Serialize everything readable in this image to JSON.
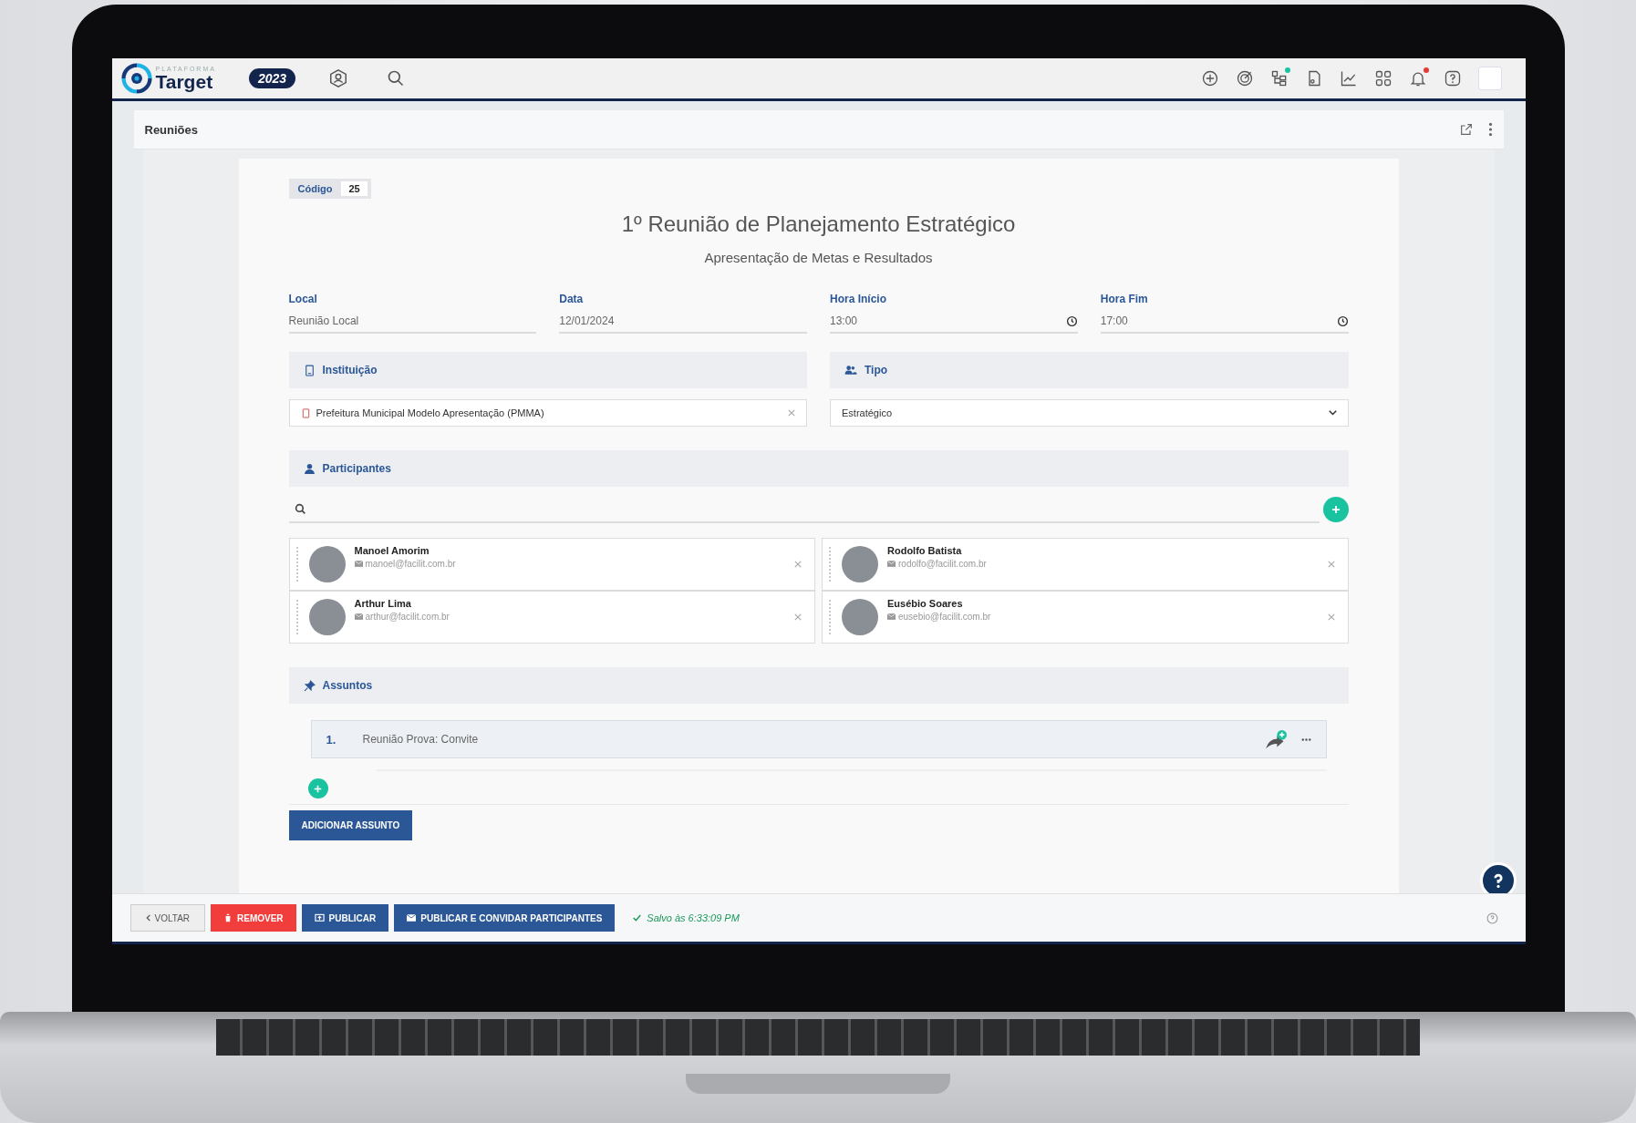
{
  "topbar": {
    "logo_small": "PLATAFORMA",
    "logo": "Target",
    "year": "2023",
    "icons": [
      {
        "kind": "plus"
      },
      {
        "kind": "target"
      },
      {
        "kind": "tree",
        "color": "#19c3a0"
      },
      {
        "kind": "doc"
      },
      {
        "kind": "chart"
      },
      {
        "kind": "grid"
      },
      {
        "kind": "bell",
        "color": "#e53935"
      },
      {
        "kind": "help"
      }
    ]
  },
  "panel": {
    "title": "Reuniões"
  },
  "code": {
    "label": "Código",
    "value": "25"
  },
  "title": "1º Reunião de Planejamento Estratégico",
  "subtitle": "Apresentação de Metas e Resultados",
  "fields": [
    {
      "label": "Local",
      "value": "Reunião Local",
      "kind": "text"
    },
    {
      "label": "Data",
      "value": "12/01/2024",
      "kind": "text"
    },
    {
      "label": "Hora Início",
      "value": "13:00",
      "kind": "time"
    },
    {
      "label": "Hora Fim",
      "value": "17:00",
      "kind": "time"
    }
  ],
  "institution": {
    "header": "Instituição",
    "value": "Prefeitura Municipal Modelo Apresentação (PMMA)"
  },
  "type": {
    "header": "Tipo",
    "value": "Estratégico"
  },
  "participants": {
    "header": "Participantes",
    "people": [
      {
        "name": "Manoel Amorim",
        "email": "manoel@facilit.com.br"
      },
      {
        "name": "Rodolfo Batista",
        "email": "rodolfo@facilit.com.br"
      },
      {
        "name": "Arthur Lima",
        "email": "arthur@facilit.com.br"
      },
      {
        "name": "Eusébio Soares",
        "email": "eusebio@facilit.com.br"
      }
    ]
  },
  "subjects": {
    "header": "Assuntos",
    "items": [
      {
        "number": "1.",
        "text": "Reunião Prova: Convite"
      }
    ],
    "add_button": "ADICIONAR ASSUNTO"
  },
  "footer": {
    "buttons": [
      {
        "kind": "back",
        "label": "VOLTAR"
      },
      {
        "kind": "danger",
        "label": "REMOVER"
      },
      {
        "kind": "publish",
        "label": "PUBLICAR"
      },
      {
        "kind": "invite",
        "label": "PUBLICAR E CONVIDAR PARTICIPANTES"
      }
    ],
    "status": "Salvo às 6:33:09 PM"
  }
}
